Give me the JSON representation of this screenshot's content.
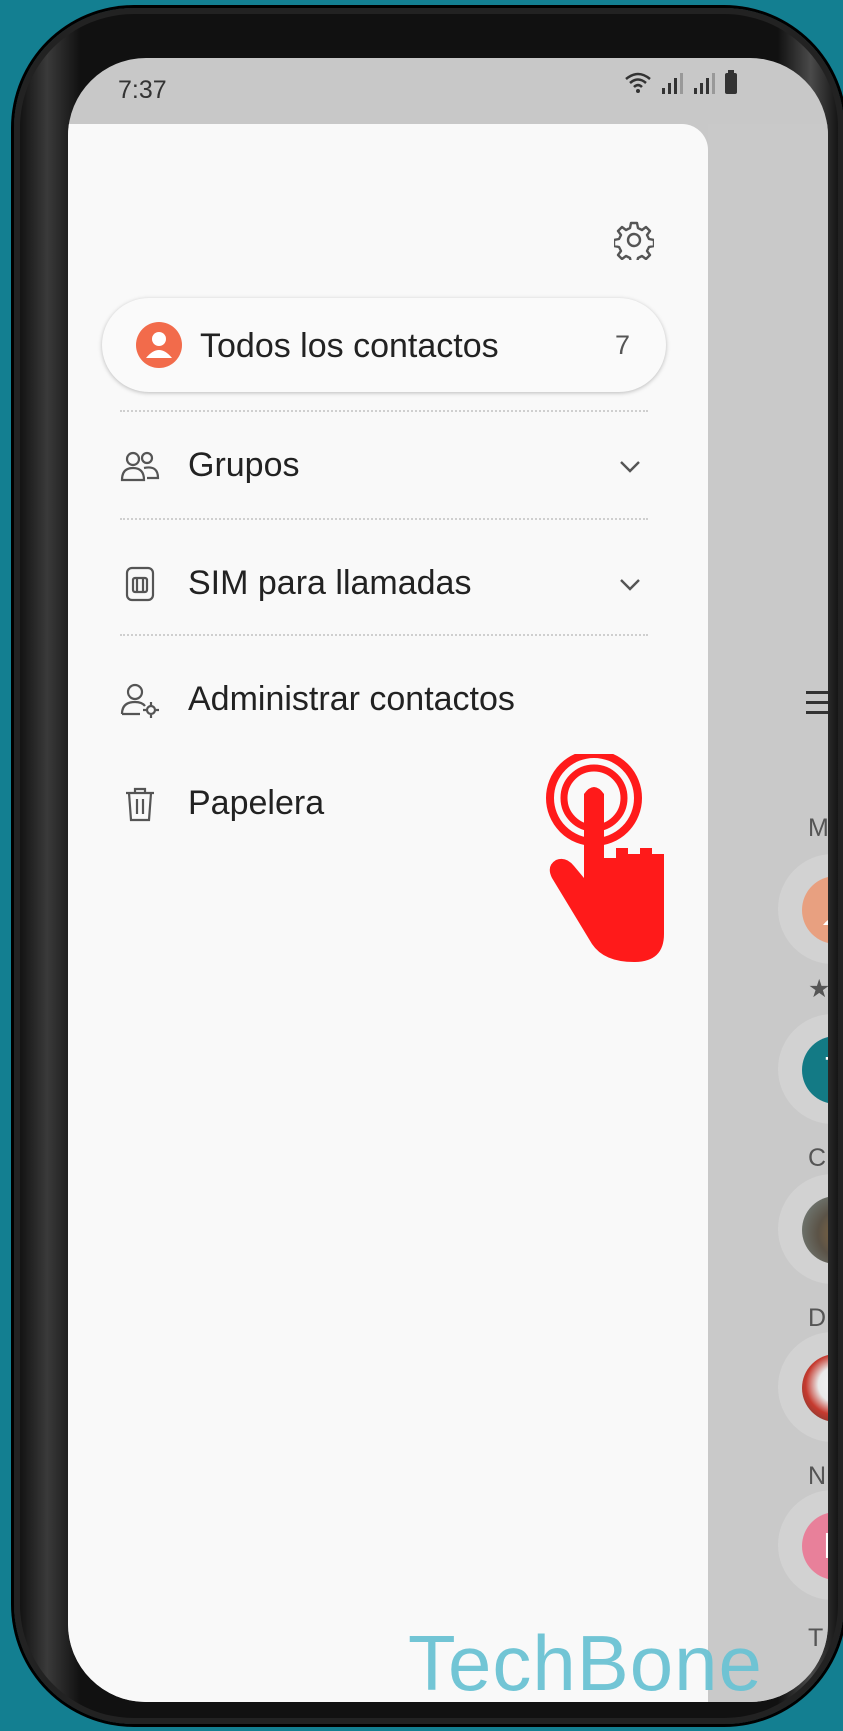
{
  "status_bar": {
    "time": "7:37"
  },
  "drawer": {
    "all_contacts": {
      "label": "Todos los contactos",
      "count": "7"
    },
    "items": [
      {
        "label": "Grupos",
        "icon": "people-icon",
        "expandable": true
      },
      {
        "label": "SIM para llamadas",
        "icon": "sim-card-icon",
        "expandable": true
      },
      {
        "label": "Administrar contactos",
        "icon": "manage-contacts-icon",
        "expandable": false
      },
      {
        "label": "Papelera",
        "icon": "trash-icon",
        "expandable": false
      }
    ]
  },
  "background_list": {
    "my_profile_label": "Mi per",
    "favorites_label": "Fa",
    "sections": [
      {
        "letter": "C"
      },
      {
        "letter": "D"
      },
      {
        "letter": "N",
        "avatar_text": "N"
      },
      {
        "letter": "T"
      }
    ],
    "favorite_avatar_text": "T"
  },
  "watermark": "TechBone",
  "colors": {
    "background": "#137f91",
    "accent_orange": "#f26b4b",
    "hand_red": "#ff1a1a",
    "avatar_teal": "#137a85",
    "avatar_pink": "#e8809a"
  }
}
